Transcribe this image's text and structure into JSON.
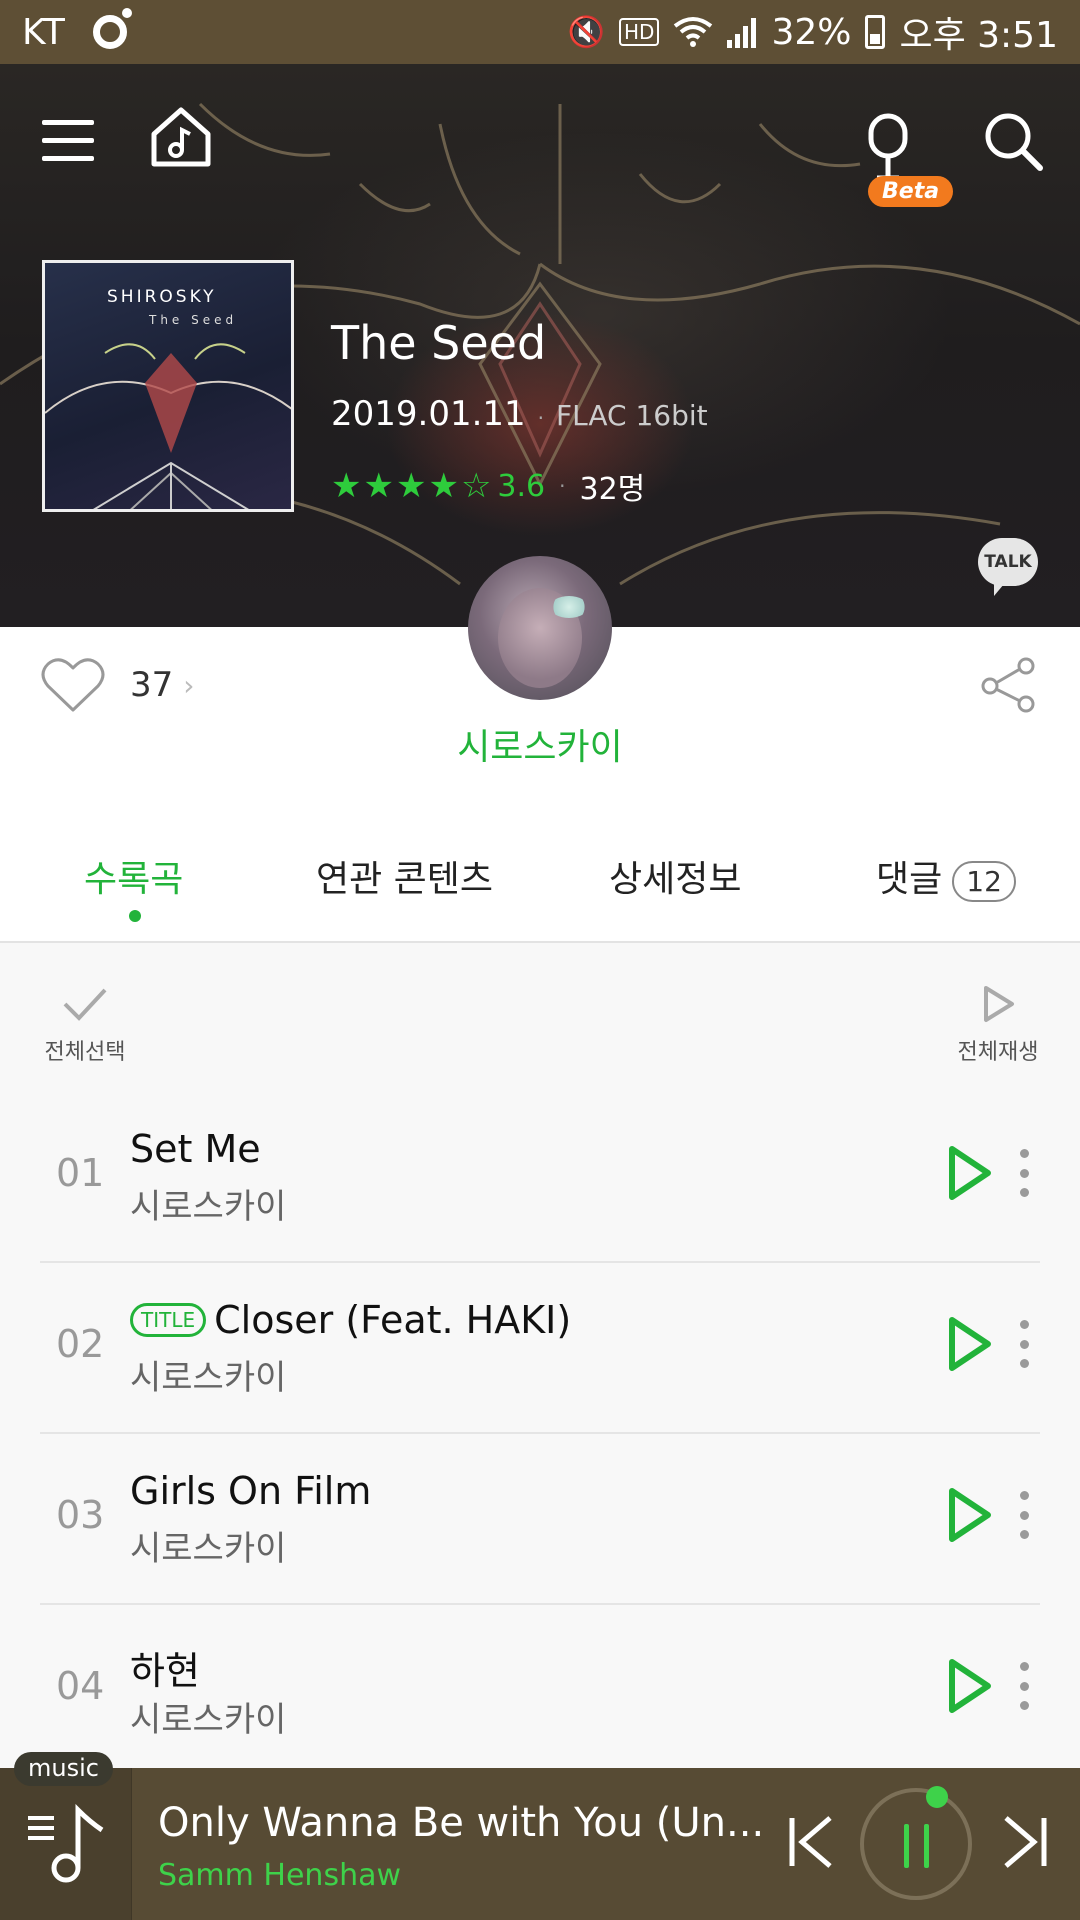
{
  "status_bar": {
    "carrier": "KT",
    "battery": "32%",
    "time": "오후 3:51",
    "icons": [
      "mute-icon",
      "hd-icon",
      "wifi-icon",
      "signal-icon",
      "battery-icon"
    ]
  },
  "header": {
    "icons": [
      "menu-icon",
      "home-music-icon",
      "mic-icon",
      "search-icon"
    ],
    "beta_label": "Beta"
  },
  "album": {
    "cover_artist": "SHIROSKY",
    "cover_title": "The Seed",
    "title": "The Seed",
    "release_date": "2019.01.11",
    "format": "FLAC 16bit",
    "rating": "3.6",
    "rating_fraction": 0.72,
    "raters": "32명",
    "talk_label": "TALK",
    "likes": "37"
  },
  "artist": {
    "name": "시로스카이"
  },
  "tabs": [
    {
      "label": "수록곡",
      "active": true
    },
    {
      "label": "연관 콘텐츠",
      "active": false
    },
    {
      "label": "상세정보",
      "active": false
    },
    {
      "label": "댓글",
      "active": false,
      "badge": "12"
    }
  ],
  "controls": {
    "select_all": "전체선택",
    "play_all": "전체재생"
  },
  "tracks": [
    {
      "num": "01",
      "title": "Set Me",
      "artist": "시로스카이",
      "tag": ""
    },
    {
      "num": "02",
      "title": "Closer (Feat. HAKI)",
      "artist": "시로스카이",
      "tag": "TITLE"
    },
    {
      "num": "03",
      "title": "Girls On Film",
      "artist": "시로스카이",
      "tag": ""
    },
    {
      "num": "04",
      "title": "하현",
      "artist": "시로스카이",
      "tag": ""
    }
  ],
  "player": {
    "chip": "music",
    "now_playing_title": "Only Wanna Be with You (Un...",
    "now_playing_artist": "Samm Henshaw"
  },
  "colors": {
    "accent": "#22b33a",
    "status_bar": "#5e4f35",
    "player": "#574b34",
    "beta": "#f27a1e"
  }
}
